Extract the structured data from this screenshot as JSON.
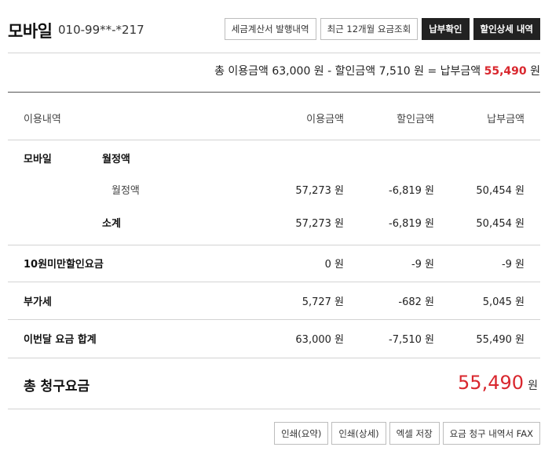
{
  "header": {
    "title": "모바일",
    "phone": "010-99**-*217",
    "buttons": {
      "tax_invoice": "세금계산서 발행내역",
      "recent_12m": "최근 12개월 요금조회",
      "payment_confirm": "납부확인",
      "discount_detail": "할인상세 내역"
    }
  },
  "summary": {
    "text_prefix": "총 이용금액 63,000 원 - 할인금액 7,510 원 = 납부금액 ",
    "pay_amount": "55,490",
    "unit": " 원"
  },
  "table": {
    "headers": {
      "item": "이용내역",
      "usage": "이용금액",
      "discount": "할인금액",
      "payment": "납부금액"
    },
    "mobile_group": {
      "category": "모바일",
      "subcategory": "월정액",
      "detail": {
        "label": "월정액",
        "usage": "57,273 원",
        "discount": "-6,819 원",
        "payment": "50,454 원"
      },
      "subtotal": {
        "label": "소계",
        "usage": "57,273 원",
        "discount": "-6,819 원",
        "payment": "50,454 원"
      }
    },
    "rows": [
      {
        "label": "10원미만할인요금",
        "usage": "0 원",
        "discount": "-9 원",
        "payment": "-9 원"
      },
      {
        "label": "부가세",
        "usage": "5,727 원",
        "discount": "-682 원",
        "payment": "5,045 원"
      },
      {
        "label": "이번달 요금 합계",
        "usage": "63,000 원",
        "discount": "-7,510 원",
        "payment": "55,490 원"
      }
    ]
  },
  "total": {
    "label": "총 청구요금",
    "amount": "55,490",
    "unit": "원"
  },
  "footer": {
    "buttons": {
      "print_summary": "인쇄(요약)",
      "print_detail": "인쇄(상세)",
      "excel_save": "엑셀 저장",
      "fax": "요금 청구 내역서 FAX"
    }
  },
  "colors": {
    "accent_red": "#d9272e",
    "dark_button": "#222222"
  }
}
